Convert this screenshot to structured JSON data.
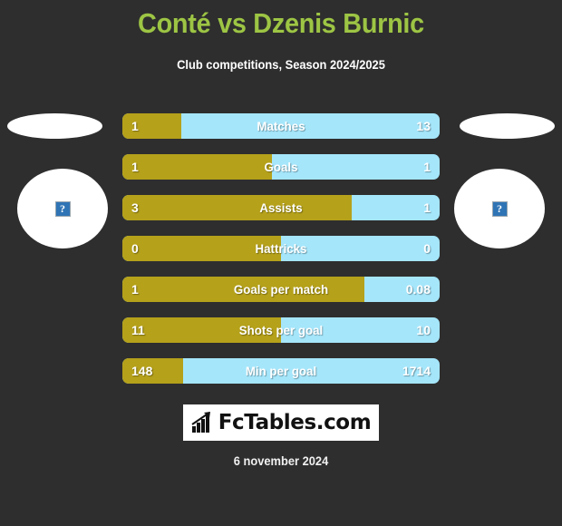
{
  "header": {
    "title": "Conté vs Dzenis Burnic",
    "subtitle": "Club competitions, Season 2024/2025",
    "title_color": "#9dc544"
  },
  "players": {
    "left": {
      "name": "",
      "avatar_icon": "broken-image-icon",
      "placeholder_glyph": "?"
    },
    "right": {
      "name": "",
      "avatar_icon": "broken-image-icon",
      "placeholder_glyph": "?"
    }
  },
  "colors": {
    "background": "#2e2e2e",
    "left_bar": "#b5a11a",
    "right_bar": "#a5e6fb",
    "title": "#9dc544",
    "text": "#ffffff"
  },
  "chart_data": {
    "type": "bar",
    "title": "Conté vs Dzenis Burnic",
    "subtitle": "Club competitions, Season 2024/2025",
    "orientation": "horizontal-diverging",
    "categories": [
      "Matches",
      "Goals",
      "Assists",
      "Hattricks",
      "Goals per match",
      "Shots per goal",
      "Min per goal"
    ],
    "series": [
      {
        "name": "Conté",
        "color": "#b5a11a",
        "values": [
          "1",
          "1",
          "3",
          "0",
          "1",
          "11",
          "148"
        ]
      },
      {
        "name": "Dzenis Burnic",
        "color": "#a5e6fb",
        "values": [
          "13",
          "1",
          "1",
          "0",
          "0.08",
          "10",
          "1714"
        ]
      }
    ],
    "rows": [
      {
        "label": "Matches",
        "left": "1",
        "right": "13",
        "left_pct": 18.6
      },
      {
        "label": "Goals",
        "left": "1",
        "right": "1",
        "left_pct": 47.1
      },
      {
        "label": "Assists",
        "left": "3",
        "right": "1",
        "left_pct": 72.3
      },
      {
        "label": "Hattricks",
        "left": "0",
        "right": "0",
        "left_pct": 50.0
      },
      {
        "label": "Goals per match",
        "left": "1",
        "right": "0.08",
        "left_pct": 76.3
      },
      {
        "label": "Shots per goal",
        "left": "11",
        "right": "10",
        "left_pct": 50.0
      },
      {
        "label": "Min per goal",
        "left": "148",
        "right": "1714",
        "left_pct": 19.1
      }
    ],
    "legend_position": "none",
    "grid": false
  },
  "footer": {
    "logo_text": "FcTables.com",
    "logo_icon": "bar-chart-icon",
    "date": "6 november 2024"
  }
}
